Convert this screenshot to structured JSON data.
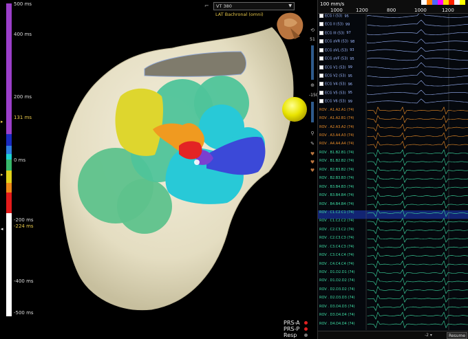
{
  "scale": {
    "ticks": [
      {
        "label": "500 ms",
        "hl": false
      },
      {
        "label": "400 ms",
        "hl": false
      },
      {
        "label": "200 ms",
        "hl": false
      },
      {
        "label": "131 ms",
        "hl": true
      },
      {
        "label": "0 ms",
        "hl": false
      },
      {
        "label": "-200 ms",
        "hl": false
      },
      {
        "label": "-224 ms",
        "hl": true
      },
      {
        "label": "-400 ms",
        "hl": false
      },
      {
        "label": "-500 ms",
        "hl": false
      }
    ],
    "colors": {
      "purple": "#9b3fc9",
      "navy": "#1a2ac0",
      "blue": "#2d7de0",
      "cyan": "#1ed2d2",
      "green": "#38b86a",
      "yellow": "#e2d21b",
      "orange": "#ee8818",
      "red": "#e41b1b",
      "white": "#ffffff"
    }
  },
  "map": {
    "map_select": "VT 380",
    "map_type": "LAT Bachronal (omni)",
    "legend": [
      {
        "label": "PRS-A",
        "color": "#e02020"
      },
      {
        "label": "PRS-P",
        "color": "#e02020"
      },
      {
        "label": "Resp",
        "color": "#777777"
      }
    ],
    "colors": {
      "shell": "#ece6cd",
      "green": "#5ec28c",
      "teal_green": "#49c3a4",
      "cyan": "#28c9d7",
      "yellow": "#ded62e",
      "orange": "#f09a20",
      "red": "#e32424",
      "blue": "#3b49d8",
      "purple": "#7b3fd0",
      "sphere": "#eae800"
    }
  },
  "toolstrip": {
    "values": [
      "51",
      "-150"
    ]
  },
  "signals": {
    "sweep_speed": "100 mm/s",
    "time_axis": [
      "1000",
      "1200",
      "800",
      "1000",
      "1200"
    ],
    "palette": [
      "#ffffff",
      "#ff7d00",
      "#4d66ff",
      "#ff00ff",
      "#ffd900",
      "#ff2200",
      "#ffffff",
      "#ffff00"
    ],
    "channels": [
      {
        "label": "ECG I (53)",
        "val": "95",
        "color": "#9eb8ff"
      },
      {
        "label": "ECG II (53)",
        "val": "99",
        "color": "#9eb8ff"
      },
      {
        "label": "ECG III (53)",
        "val": "97",
        "color": "#9eb8ff"
      },
      {
        "label": "ECG aVR (53)",
        "val": "98",
        "color": "#9eb8ff"
      },
      {
        "label": "ECG aVL (53)",
        "val": "93",
        "color": "#9eb8ff"
      },
      {
        "label": "ECG aVF (53)",
        "val": "95",
        "color": "#9eb8ff"
      },
      {
        "label": "ECG V1 (53)",
        "val": "99",
        "color": "#9eb8ff"
      },
      {
        "label": "ECG V2 (53)",
        "val": "95",
        "color": "#9eb8ff"
      },
      {
        "label": "ECG V4 (53)",
        "val": "96",
        "color": "#9eb8ff"
      },
      {
        "label": "ECG V5 (53)",
        "val": "95",
        "color": "#9eb8ff"
      },
      {
        "label": "ECG V6 (53)",
        "val": "99",
        "color": "#9eb8ff"
      },
      {
        "label": "ROV . A1.A2.A1 (74)",
        "val": "",
        "color": "#f0912a"
      },
      {
        "label": "ROV . A1.A2.B1 (74)",
        "val": "",
        "color": "#f0912a"
      },
      {
        "label": "ROV . A2.A3.A2 (74)",
        "val": "",
        "color": "#f0912a"
      },
      {
        "label": "ROV . A3.A4.A3 (74)",
        "val": "",
        "color": "#f0912a"
      },
      {
        "label": "ROV . A4.A4.A4 (74)",
        "val": "",
        "color": "#f0912a"
      },
      {
        "label": "ROV . B1.B2.B1 (74)",
        "val": "",
        "color": "#3fe0a6"
      },
      {
        "label": "ROV . B1.B2.B2 (74)",
        "val": "",
        "color": "#3fe0a6"
      },
      {
        "label": "ROV . B2.B3.B2 (74)",
        "val": "",
        "color": "#3fe0a6"
      },
      {
        "label": "ROV . B2.B3.B3 (74)",
        "val": "",
        "color": "#3fe0a6"
      },
      {
        "label": "ROV . B3.B4.B3 (74)",
        "val": "",
        "color": "#3fe0a6"
      },
      {
        "label": "ROV . B3.B4.B4 (74)",
        "val": "",
        "color": "#3fe0a6"
      },
      {
        "label": "ROV . B4.B4.B4 (74)",
        "val": "",
        "color": "#3fe0a6"
      },
      {
        "label": "ROV . C1.C2.C1 (74)",
        "val": "",
        "color": "#3fe0a6"
      },
      {
        "label": "ROV . C1.C2.C2 (74)",
        "val": "",
        "color": "#3fe0a6"
      },
      {
        "label": "ROV . C2.C3.C2 (74)",
        "val": "",
        "color": "#3fe0a6"
      },
      {
        "label": "ROV . C2.C3.C3 (74)",
        "val": "",
        "color": "#3fe0a6"
      },
      {
        "label": "ROV . C3.C4.C3 (74)",
        "val": "",
        "color": "#3fe0a6"
      },
      {
        "label": "ROV . C3.C4.C4 (74)",
        "val": "",
        "color": "#3fe0a6"
      },
      {
        "label": "ROV . C4.C4.C4 (74)",
        "val": "",
        "color": "#3fe0a6"
      },
      {
        "label": "ROV . D1.D2.D1 (74)",
        "val": "",
        "color": "#3fe0a6"
      },
      {
        "label": "ROV . D1.D2.D2 (74)",
        "val": "",
        "color": "#3fe0a6"
      },
      {
        "label": "ROV . D2.D3.D2 (74)",
        "val": "",
        "color": "#3fe0a6"
      },
      {
        "label": "ROV . D2.D3.D3 (74)",
        "val": "",
        "color": "#3fe0a6"
      },
      {
        "label": "ROV . D3.D4.D3 (74)",
        "val": "",
        "color": "#3fe0a6"
      },
      {
        "label": "ROV . D3.D4.D4 (74)",
        "val": "",
        "color": "#3fe0a6"
      },
      {
        "label": "ROV . D4.D4.D4 (74)",
        "val": "",
        "color": "#3fe0a6"
      }
    ],
    "resume_label": "Resume",
    "pager": "-2 ▾"
  }
}
